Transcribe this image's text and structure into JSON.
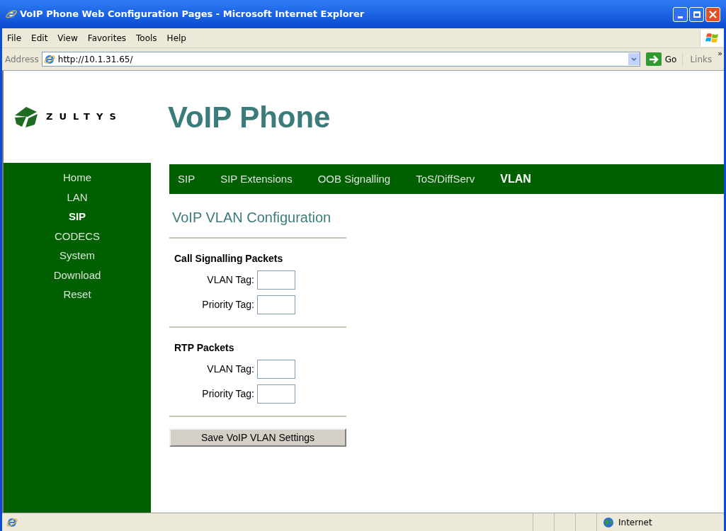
{
  "window": {
    "title": "VoIP Phone Web Configuration Pages - Microsoft Internet Explorer"
  },
  "menu": [
    "File",
    "Edit",
    "View",
    "Favorites",
    "Tools",
    "Help"
  ],
  "address_bar": {
    "label": "Address",
    "value": "http://10.1.31.65/",
    "go": "Go",
    "links": "Links",
    "more": "»"
  },
  "header": {
    "logo": "ZULTYS",
    "title": "VoIP Phone"
  },
  "sidebar": {
    "items": [
      {
        "label": "Home",
        "selected": false
      },
      {
        "label": "LAN",
        "selected": false
      },
      {
        "label": "SIP",
        "selected": true
      },
      {
        "label": "CODECS",
        "selected": false
      },
      {
        "label": "System",
        "selected": false
      },
      {
        "label": "Download",
        "selected": false
      },
      {
        "label": "Reset",
        "selected": false
      }
    ]
  },
  "tabs": [
    {
      "label": "SIP",
      "selected": false
    },
    {
      "label": "SIP Extensions",
      "selected": false
    },
    {
      "label": "OOB Signalling",
      "selected": false
    },
    {
      "label": "ToS/DiffServ",
      "selected": false
    },
    {
      "label": "VLAN",
      "selected": true
    }
  ],
  "page_title": "VoIP VLAN Configuration",
  "sections": [
    {
      "heading": "Call Signalling Packets",
      "fields": [
        {
          "label": "VLAN Tag:"
        },
        {
          "label": "Priority Tag:"
        }
      ]
    },
    {
      "heading": "RTP Packets",
      "fields": [
        {
          "label": "VLAN Tag:"
        },
        {
          "label": "Priority Tag:"
        }
      ]
    }
  ],
  "save_button": "Save VoIP VLAN Settings",
  "status_bar": {
    "zone": "Internet"
  }
}
